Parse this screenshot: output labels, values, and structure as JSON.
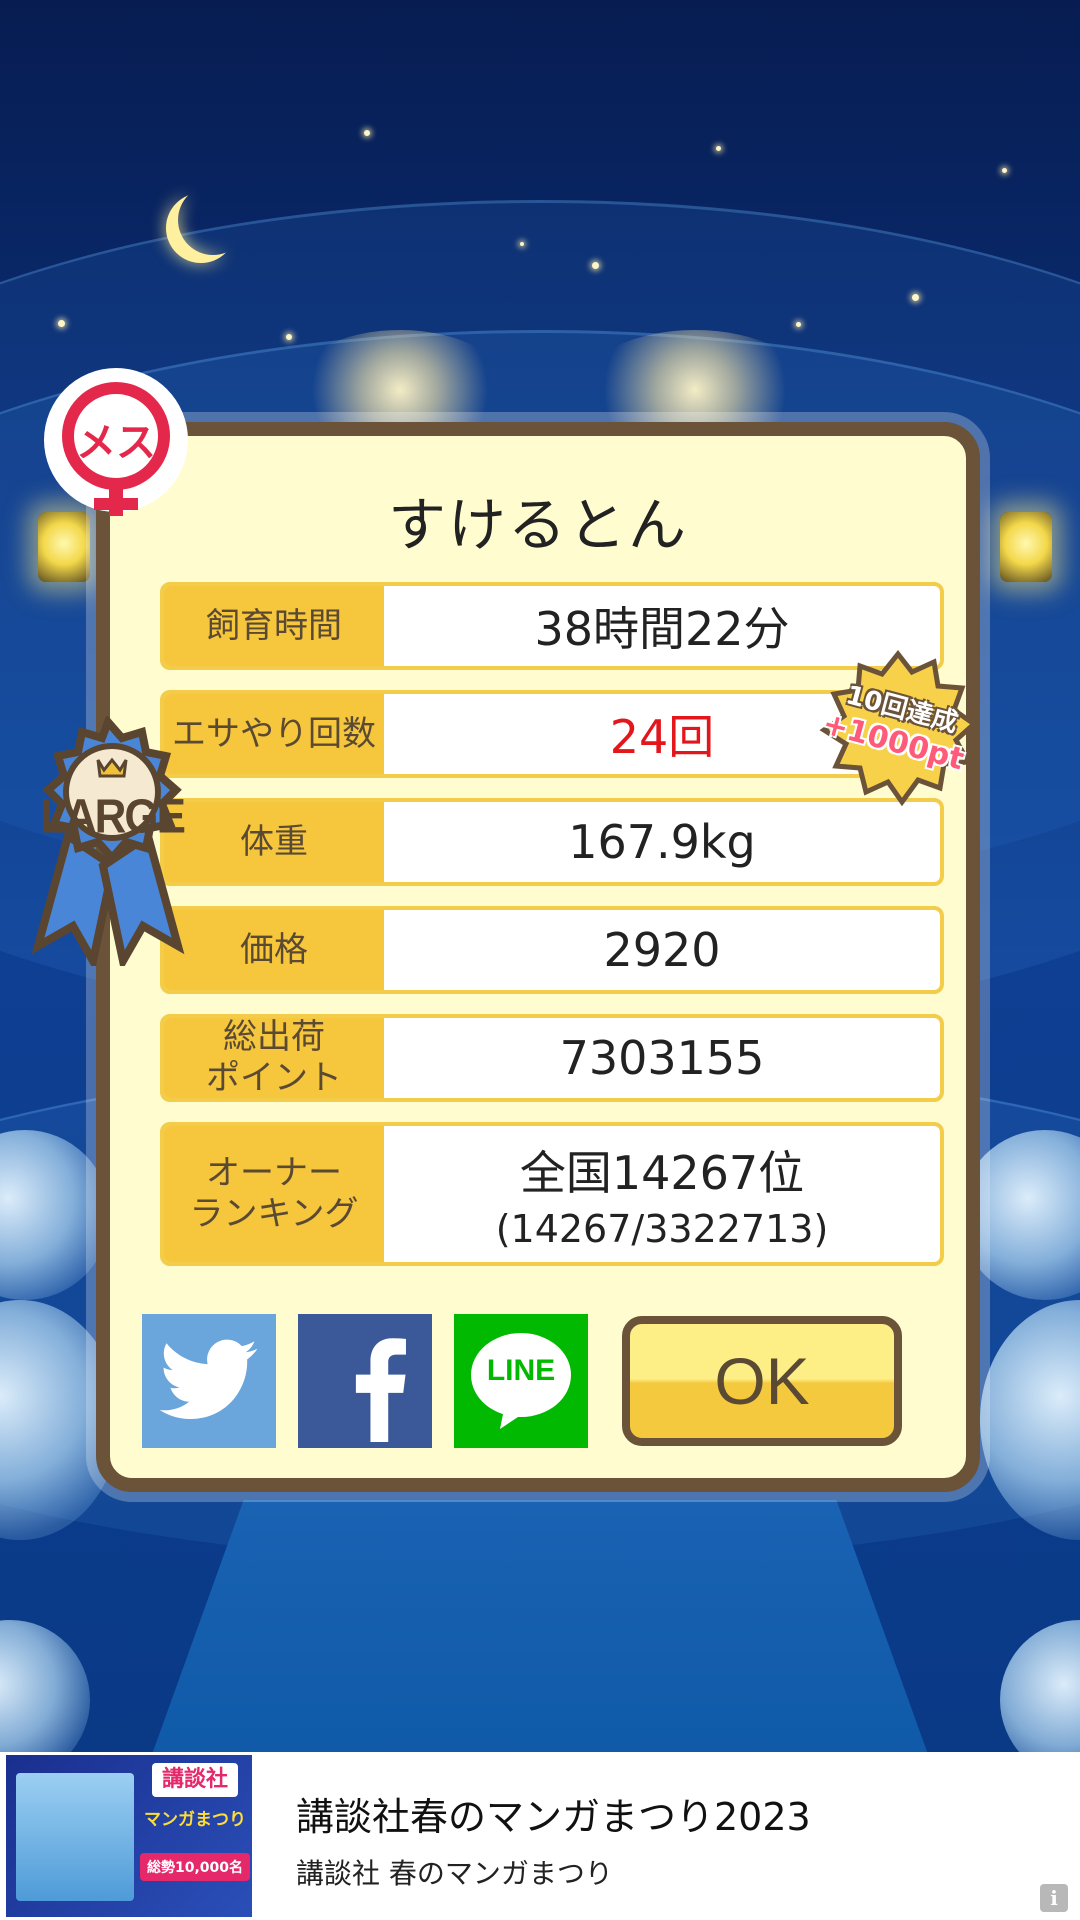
{
  "pet": {
    "name": "すけるとん",
    "gender_label": "メス",
    "size_badge": "LARGE",
    "achievement_badge": {
      "line1": "10回達成",
      "line2": "+1000pt"
    }
  },
  "stats": [
    {
      "label": "飼育時間",
      "value": "38時間22分"
    },
    {
      "label": "エサやり回数",
      "value": "24回",
      "highlight": true
    },
    {
      "label": "体重",
      "value": "167.9kg"
    },
    {
      "label": "価格",
      "value": "2920"
    },
    {
      "label": "総出荷\nポイント",
      "value": "7303155"
    },
    {
      "label": "オーナー\nランキング",
      "value": "全国14267位",
      "sub": "(14267/3322713)"
    }
  ],
  "buttons": {
    "line_label": "LINE",
    "ok_label": "OK"
  },
  "ad": {
    "title": "講談社春のマンガまつり2023",
    "subtitle": "講談社 春のマンガまつり",
    "thumb_line1": "講談社",
    "thumb_line2": "マンガまつり",
    "thumb_line3": "総勢10,000名",
    "info_icon": "i"
  },
  "colors": {
    "frame": "#6b5339",
    "panel": "#fffcd0",
    "label_bg": "#f6c63c",
    "highlight": "#e2161b",
    "twitter": "#6aa6dc",
    "facebook": "#3b5998",
    "line": "#00b900"
  }
}
